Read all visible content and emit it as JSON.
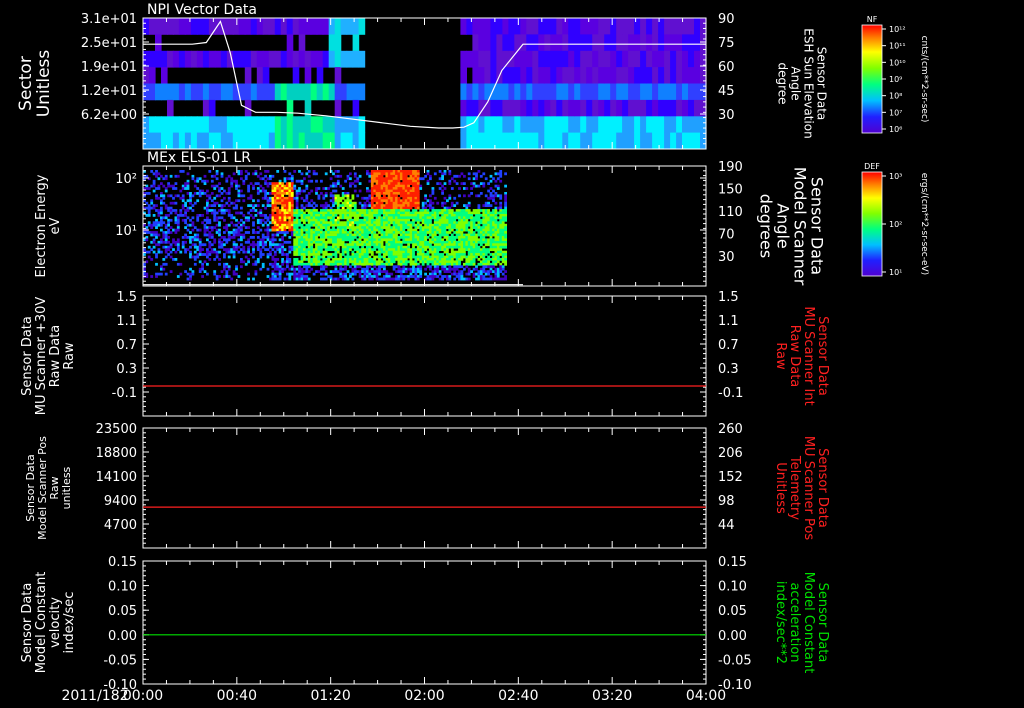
{
  "time_axis": {
    "date_label": "2011/182",
    "ticks": [
      "00:00",
      "00:40",
      "01:20",
      "02:00",
      "02:40",
      "03:20",
      "04:00"
    ]
  },
  "colorbars": [
    {
      "title": "NF",
      "units": "cnts/(cm**2-sr-sec)",
      "tick_labels": [
        "10¹²",
        "10¹¹",
        "10¹⁰",
        "10⁹",
        "10⁸",
        "10⁷",
        "10⁶"
      ]
    },
    {
      "title": "DEF",
      "units": "ergs/(cm**2-sr-sec-eV)",
      "tick_labels": [
        "10³",
        "10²",
        "10¹"
      ]
    }
  ],
  "chart_data": [
    {
      "type": "heatmap",
      "title": "NPI Vector Data",
      "ylabel": [
        "Sector",
        "Unitless"
      ],
      "y_ticks": [
        "3.1e+01",
        "2.5e+01",
        "1.9e+01",
        "1.2e+01",
        "6.2e+00"
      ],
      "y2label": [
        "Sensor Data",
        "ESH Sun Elevation",
        "Angle",
        "degree"
      ],
      "y2_ticks": [
        "90",
        "75",
        "60",
        "45",
        "30"
      ],
      "y2lim": [
        15,
        90
      ],
      "overlay_line": {
        "color": "#ffffff",
        "x_hours": [
          0.0,
          0.35,
          0.45,
          0.55,
          0.62,
          0.7,
          0.8,
          0.95,
          1.1,
          1.3,
          1.5,
          1.7,
          1.9,
          2.1,
          2.2,
          2.28,
          2.35,
          2.45,
          2.55,
          2.7,
          3.0,
          3.5,
          4.0
        ],
        "y": [
          75,
          75,
          76,
          88,
          70,
          40,
          36,
          36,
          35.5,
          34,
          32,
          30,
          28,
          27,
          27,
          27.5,
          30,
          42,
          60,
          75,
          75,
          75,
          75
        ]
      },
      "data_gap": {
        "start": "01:35",
        "end": "02:15"
      }
    },
    {
      "type": "heatmap",
      "title": "MEx ELS-01 LR",
      "ylabel": [
        "Electron Energy",
        "eV"
      ],
      "y_ticks": [
        "10²",
        "10¹"
      ],
      "y2label": [
        "Sensor Data",
        "Model Scanner",
        "Angle",
        "degrees"
      ],
      "y2_ticks": [
        "190",
        "150",
        "110",
        "70",
        "30"
      ],
      "y2lim": [
        0,
        190
      ],
      "overlay_line": {
        "color": "#ffffff",
        "x_hours": [
          0.0,
          2.7
        ],
        "y": [
          2,
          2
        ]
      },
      "data_range": {
        "start": "00:00",
        "end": "02:35"
      }
    },
    {
      "type": "line",
      "ylabel": [
        "Sensor Data",
        "MU Scanner +30V",
        "Raw Data",
        "Raw"
      ],
      "y_ticks": [
        "1.5",
        "1.1",
        "0.7",
        "0.3",
        "-0.1"
      ],
      "ylim": [
        -0.5,
        1.5
      ],
      "y2label": [
        "Sensor Data",
        "MU Scanner Int",
        "Raw Data",
        "Raw"
      ],
      "y2_ticks": [
        "1.5",
        "1.1",
        "0.7",
        "0.3",
        "-0.1"
      ],
      "series": [
        {
          "color": "#ff2020",
          "x_hours": [
            0,
            4
          ],
          "y": [
            0,
            0
          ]
        }
      ]
    },
    {
      "type": "line",
      "ylabel": [
        "Sensor Data",
        "Model Scanner Pos",
        "Raw",
        "unitless"
      ],
      "y_ticks": [
        "23500",
        "18800",
        "14100",
        "9400",
        "4700"
      ],
      "ylim": [
        0,
        23500
      ],
      "y2label": [
        "Sensor Data",
        "MU Scanner Pos",
        "Telemetry",
        "Unitless"
      ],
      "y2_ticks": [
        "260",
        "206",
        "152",
        "98",
        "44"
      ],
      "series": [
        {
          "color": "#ff2020",
          "x_hours": [
            0,
            4
          ],
          "y": [
            8000,
            8000
          ]
        }
      ]
    },
    {
      "type": "line",
      "ylabel": [
        "Sensor Data",
        "Model Constant",
        "velocity",
        "index/sec"
      ],
      "y_ticks": [
        "0.15",
        "0.10",
        "0.05",
        "0.00",
        "-0.05",
        "-0.10"
      ],
      "ylim": [
        -0.1,
        0.15
      ],
      "y2label": [
        "Sensor Data",
        "Model Constant",
        "acceleration",
        "index/sec**2"
      ],
      "y2_ticks": [
        "0.15",
        "0.10",
        "0.05",
        "0.00",
        "-0.05",
        "-0.10"
      ],
      "series": [
        {
          "color": "#00e000",
          "x_hours": [
            0,
            4
          ],
          "y": [
            0,
            0
          ]
        }
      ]
    }
  ]
}
